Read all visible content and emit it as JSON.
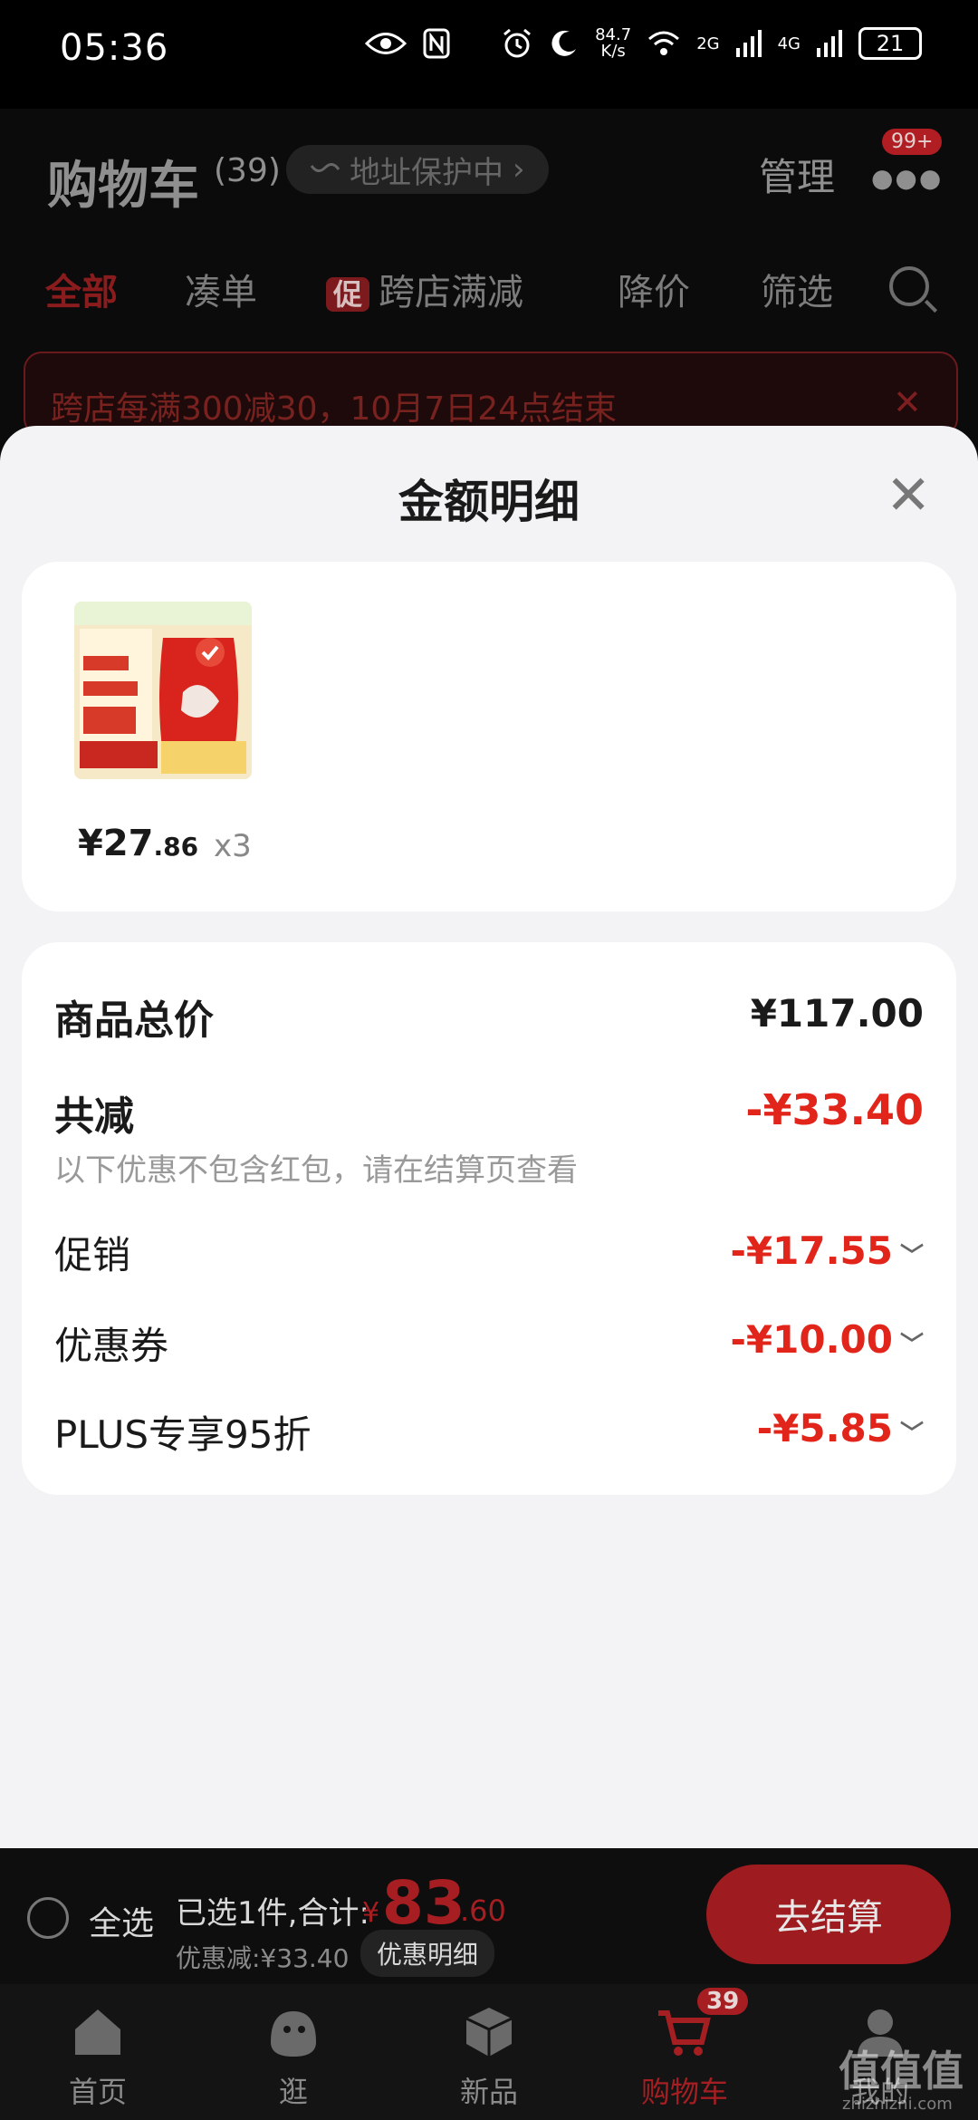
{
  "status_bar": {
    "time": "05:36",
    "net_speed_value": "84.7",
    "net_speed_unit": "K/s",
    "sim1": "2G",
    "sim2": "4G",
    "battery": "21"
  },
  "header": {
    "title": "购物车",
    "count": "(39)",
    "address_pill": "地址保护中",
    "manage": "管理",
    "badge": "99+"
  },
  "tabs": {
    "all": "全部",
    "bundle": "凑单",
    "promo_icon": "促",
    "cross_store": "跨店满减",
    "price_drop": "降价",
    "filter": "筛选"
  },
  "promo_banner": {
    "text": "跨店每满300减30，10月7日24点结束",
    "close": "✕"
  },
  "sheet": {
    "title": "金额明细",
    "close": "✕"
  },
  "product": {
    "price_int": "¥27",
    "price_dec": ".86",
    "qty": "x3"
  },
  "summary": {
    "total_label": "商品总价",
    "total_value": "¥117.00",
    "reduce_label": "共减",
    "reduce_value": "-¥33.40",
    "note": "以下优惠不包含红包，请在结算页查看",
    "items": [
      {
        "label": "促销",
        "value": "-¥17.55"
      },
      {
        "label": "优惠券",
        "value": "-¥10.00"
      },
      {
        "label": "PLUS专享95折",
        "value": "-¥5.85"
      }
    ]
  },
  "action_bar": {
    "select_all": "全选",
    "selected": "已选1件,合计:",
    "yen": "¥",
    "total_int": "83",
    "total_dec": ".60",
    "discount": "优惠减:¥33.40",
    "detail": "优惠明细",
    "checkout": "去结算"
  },
  "tabbar": {
    "items": [
      {
        "label": "首页",
        "icon": "home-icon"
      },
      {
        "label": "逛",
        "icon": "browse-icon"
      },
      {
        "label": "新品",
        "icon": "new-box-icon"
      },
      {
        "label": "购物车",
        "icon": "cart-icon"
      },
      {
        "label": "我的",
        "icon": "profile-icon"
      }
    ],
    "cart_badge": "39"
  },
  "watermark": {
    "logo": "值值值",
    "url": "zhizhizhi.com"
  },
  "colors": {
    "accent": "#e1251b",
    "sheet_bg": "#f3f3f5",
    "dim_bg": "#0b0b0b"
  }
}
